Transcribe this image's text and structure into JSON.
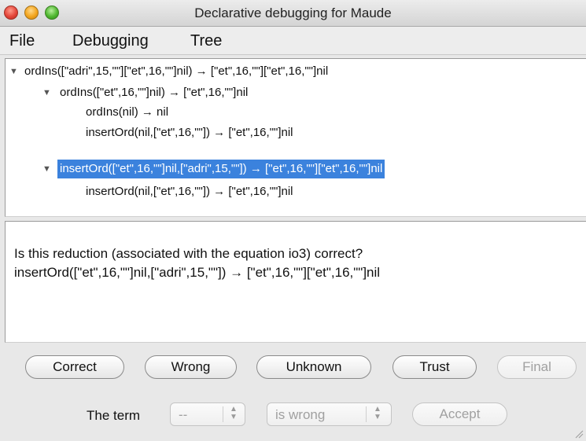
{
  "window": {
    "title": "Declarative debugging for Maude"
  },
  "menu": {
    "file": "File",
    "debugging": "Debugging",
    "tree": "Tree"
  },
  "tree": {
    "rows": [
      {
        "label": "ordIns([\"adri\",15,\"\"][\"et\",16,\"\"]nil) → [\"et\",16,\"\"][\"et\",16,\"\"]nil",
        "toggle": "▼"
      },
      {
        "label": "ordIns([\"et\",16,\"\"]nil) → [\"et\",16,\"\"]nil",
        "toggle": "▼"
      },
      {
        "label": "ordIns(nil) → nil"
      },
      {
        "label": "insertOrd(nil,[\"et\",16,\"\"]) → [\"et\",16,\"\"]nil"
      },
      {
        "label": "insertOrd([\"et\",16,\"\"]nil,[\"adri\",15,\"\"]) → [\"et\",16,\"\"][\"et\",16,\"\"]nil",
        "toggle": "▼",
        "selected": true
      },
      {
        "label": "insertOrd(nil,[\"et\",16,\"\"]) → [\"et\",16,\"\"]nil"
      }
    ]
  },
  "question": {
    "line1": "Is this reduction (associated with the equation io3) correct?",
    "line2": "insertOrd([\"et\",16,\"\"]nil,[\"adri\",15,\"\"]) → [\"et\",16,\"\"][\"et\",16,\"\"]nil"
  },
  "buttons": {
    "correct": "Correct",
    "wrong": "Wrong",
    "unknown": "Unknown",
    "trust": "Trust",
    "final": "Final",
    "accept": "Accept"
  },
  "term": {
    "label": "The term",
    "selector_value": "--",
    "status_value": "is wrong",
    "stepper_glyph": "▲▼"
  },
  "icons": {
    "close": "close-icon",
    "minimize": "minimize-icon",
    "maximize": "maximize-icon",
    "disclosure": "disclosure-triangle-icon",
    "resize": "resize-grip-icon"
  },
  "colors": {
    "selection": "#3b82dd",
    "close": "#e4463a",
    "minimize": "#f3a51d",
    "maximize": "#4fb72f"
  }
}
